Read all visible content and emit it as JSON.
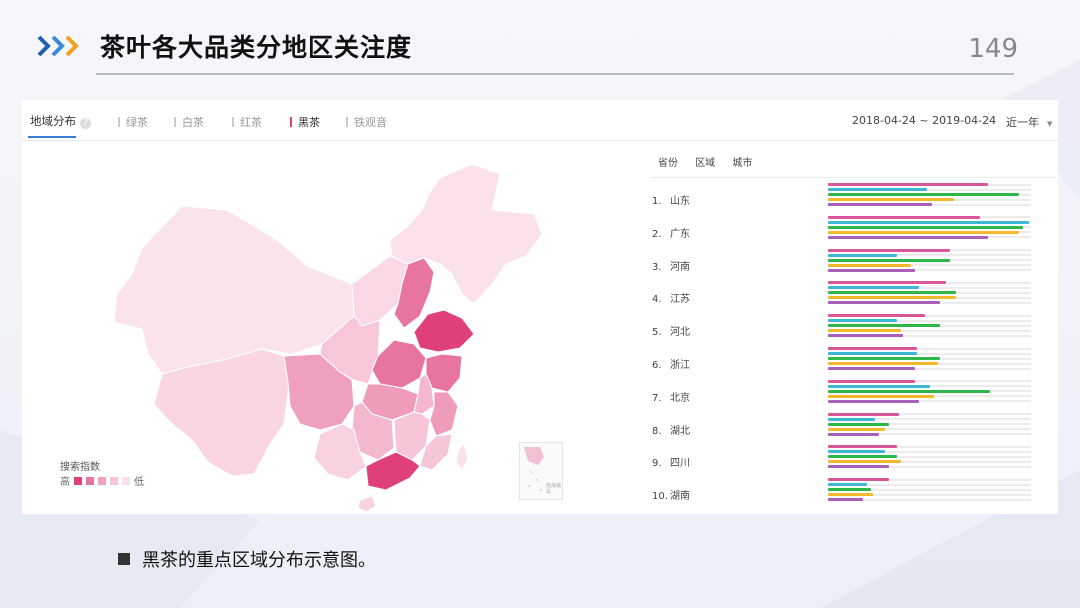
{
  "slide": {
    "title": "茶叶各大品类分地区关注度",
    "page_number": "149",
    "caption": "黑茶的重点区域分布示意图。"
  },
  "panel": {
    "main_tab": "地域分布",
    "help_icon": "question-icon",
    "tabs": [
      {
        "label": "绿茶",
        "active": false
      },
      {
        "label": "白茶",
        "active": false
      },
      {
        "label": "红茶",
        "active": false
      },
      {
        "label": "黑茶",
        "active": true
      },
      {
        "label": "铁观音",
        "active": false
      }
    ],
    "date_range": "2018-04-24 ~ 2019-04-24",
    "period": "近一年",
    "accent_color": "#e0407a"
  },
  "legend": {
    "title": "搜索指数",
    "high": "高",
    "low": "低",
    "colors": [
      "#e0407a",
      "#e874a0",
      "#efa0be",
      "#f5c4d6",
      "#fae0ea"
    ]
  },
  "inset": {
    "label": "南海诸岛"
  },
  "ranking": {
    "tabs": [
      "省份",
      "区域",
      "城市"
    ],
    "series_colors": [
      "#d9569b",
      "#3cb8d6",
      "#2fb84a",
      "#f2b92c",
      "#a860b8"
    ],
    "rows": [
      {
        "rank": "1.",
        "name": "山东",
        "values": [
          0.79,
          0.49,
          0.94,
          0.62,
          0.51
        ]
      },
      {
        "rank": "2.",
        "name": "广东",
        "values": [
          0.75,
          0.99,
          0.96,
          0.94,
          0.79
        ]
      },
      {
        "rank": "3.",
        "name": "河南",
        "values": [
          0.6,
          0.34,
          0.6,
          0.41,
          0.43
        ]
      },
      {
        "rank": "4.",
        "name": "江苏",
        "values": [
          0.58,
          0.45,
          0.63,
          0.63,
          0.55
        ]
      },
      {
        "rank": "5.",
        "name": "河北",
        "values": [
          0.48,
          0.34,
          0.55,
          0.36,
          0.37
        ]
      },
      {
        "rank": "6.",
        "name": "浙江",
        "values": [
          0.44,
          0.44,
          0.55,
          0.54,
          0.43
        ]
      },
      {
        "rank": "7.",
        "name": "北京",
        "values": [
          0.43,
          0.5,
          0.8,
          0.52,
          0.45
        ]
      },
      {
        "rank": "8.",
        "name": "湖北",
        "values": [
          0.35,
          0.23,
          0.3,
          0.28,
          0.25
        ]
      },
      {
        "rank": "9.",
        "name": "四川",
        "values": [
          0.34,
          0.28,
          0.34,
          0.36,
          0.3
        ]
      },
      {
        "rank": "10.",
        "name": "湖南",
        "values": [
          0.3,
          0.19,
          0.21,
          0.22,
          0.17
        ]
      }
    ]
  }
}
